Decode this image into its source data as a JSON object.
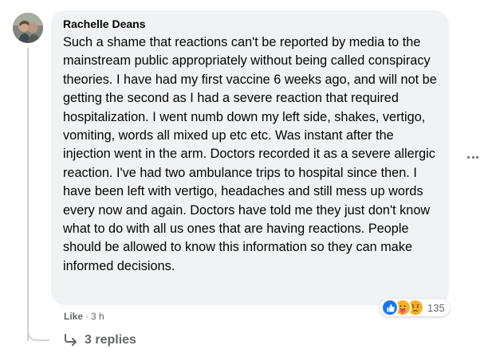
{
  "comment": {
    "author": "Rachelle Deans",
    "text": "Such a shame that reactions can't be reported by media to the mainstream public appropriately without being called conspiracy theories. I have had my first vaccine 6 weeks ago, and will not be getting the second as I had a severe reaction that required hospitalization. I went numb down my left side, shakes, vertigo, vomiting, words all mixed up etc etc. Was instant after the injection went in the arm. Doctors recorded it as a severe allergic reaction. I've had two ambulance trips to hospital since then. I have been left with vertigo, headaches and still mess up words every now and again. Doctors have told me they just don't know what to do with all us ones that are having reactions. People should be allowed to know this information so they can make informed decisions.",
    "reactions": {
      "icons": [
        "like-icon",
        "care-icon",
        "sad-icon"
      ],
      "count": "135"
    },
    "actions": {
      "like_label": "Like",
      "separator": "·",
      "timestamp": "3 h"
    },
    "replies_label": "3 replies"
  },
  "colors": {
    "bubble": "#f0f2f5",
    "text": "#050505",
    "secondary": "#65676b",
    "like_blue": "#1877f2",
    "reaction_yellow": "#f7b125"
  }
}
